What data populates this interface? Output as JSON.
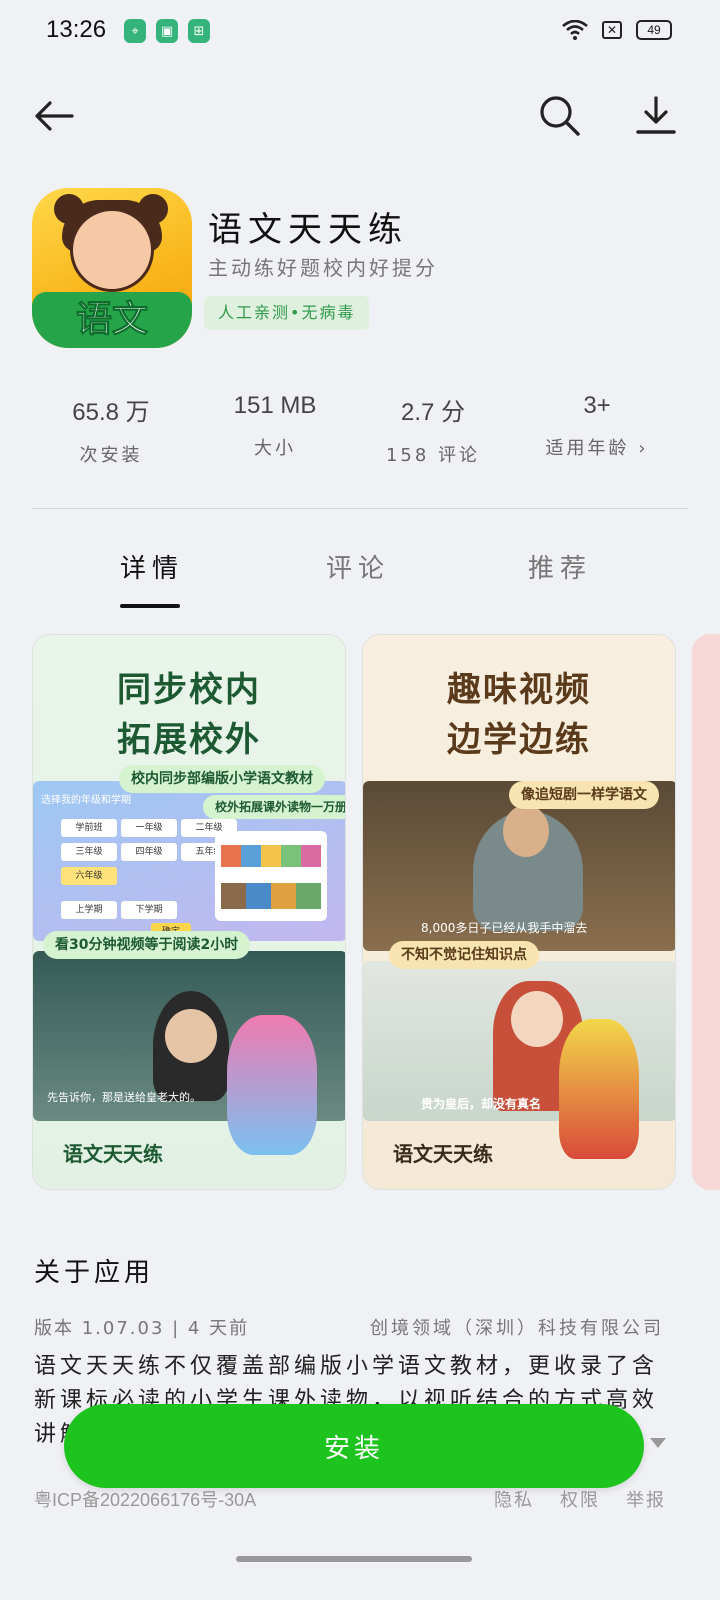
{
  "status_bar": {
    "time": "13:26",
    "battery": "49"
  },
  "app": {
    "name": "语文天天练",
    "icon_label": "语文",
    "slogan": "主动练好题校内好提分",
    "badge": "人工亲测•无病毒"
  },
  "stats": [
    {
      "value": "65.8 万",
      "label": "次安装"
    },
    {
      "value": "151 MB",
      "label": "大小"
    },
    {
      "value": "2.7 分",
      "label": "158 评论"
    },
    {
      "value": "3+",
      "label": "适用年龄 ›"
    }
  ],
  "tabs": [
    {
      "label": "详情",
      "active": true
    },
    {
      "label": "评论",
      "active": false
    },
    {
      "label": "推荐",
      "active": false
    }
  ],
  "screenshots": [
    {
      "title_line1": "同步校内",
      "title_line2": "拓展校外",
      "chip1": "校内同步部编版小学语文教材",
      "chip2": "校外拓展课外读物一万册",
      "chip3": "看30分钟视频等于阅读2小时",
      "panel_heading": "选择我的年级和学期",
      "grades": [
        "学前班",
        "一年级",
        "二年级",
        "三年级",
        "四年级",
        "五年级",
        "六年级"
      ],
      "terms": [
        "上学期",
        "下学期"
      ],
      "confirm": "确定",
      "caption": "先告诉你，那是送给皇老大的。",
      "brand": "语文天天练"
    },
    {
      "title_line1": "趣味视频",
      "title_line2": "边学边练",
      "chip1": "像追短剧一样学语文",
      "chip2": "不知不觉记住知识点",
      "caption1": "8,000多日子已经从我手中溜去",
      "caption2": "贵为皇后，却没有真名",
      "brand": "语文天天练"
    }
  ],
  "about": {
    "title": "关于应用",
    "version": "版本 1.07.03 | 4 天前",
    "developer": "创境领域（深圳）科技有限公司",
    "description": "语文天天练不仅覆盖部编版小学语文教材，更收录了含新课标必读的小学生课外读物，以视听结合的方式高效讲解…",
    "icp": "粤ICP备2022066176号-30A",
    "links": [
      "隐私",
      "权限",
      "举报"
    ]
  },
  "install_label": "安装",
  "colors": {
    "install_green": "#1ec41e",
    "badge_green": "#2f9a4c",
    "background": "#f0f1f5"
  }
}
